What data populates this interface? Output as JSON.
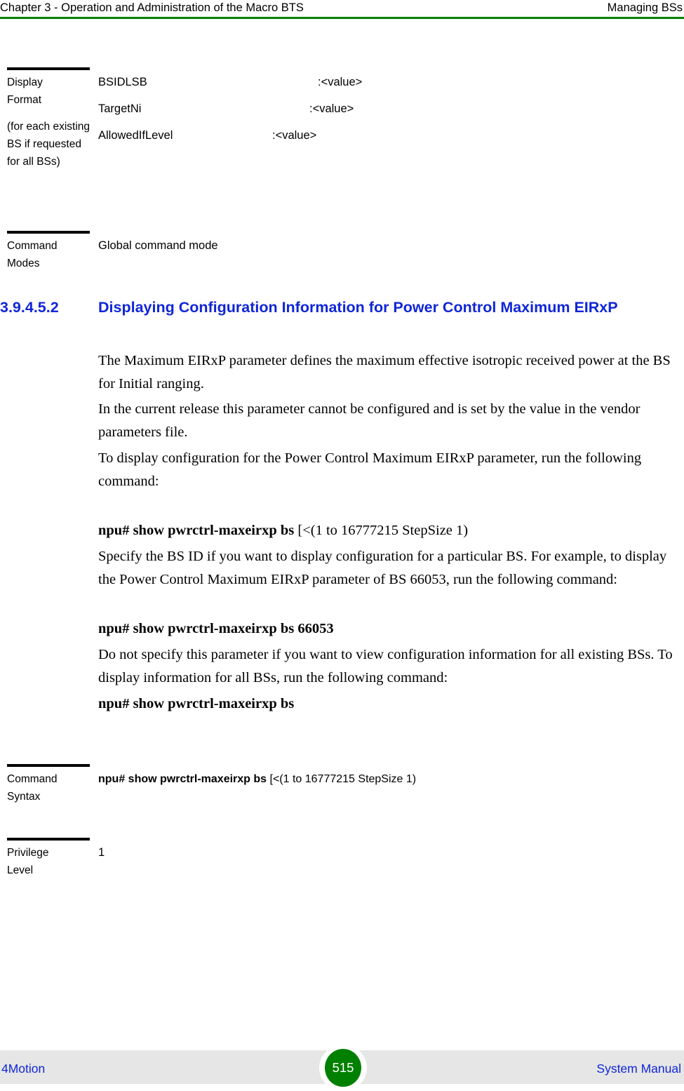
{
  "header": {
    "left": "Chapter 3 - Operation and Administration of the Macro BTS",
    "right": "Managing BSs",
    "rule_color": "#008000"
  },
  "display_format_table": {
    "label": "Display Format",
    "label_line1": "Display",
    "label_line2": "Format",
    "label_note": "(for each existing BS if requested for all BSs)",
    "rows": [
      {
        "name": "BSIDLSB",
        "value": ":<value>"
      },
      {
        "name": "TargetNi",
        "value": ":<value>"
      },
      {
        "name": "AllowedIfLevel",
        "value": ":<value>"
      }
    ]
  },
  "command_modes_table": {
    "label_line1": "Command",
    "label_line2": "Modes",
    "value": "Global command mode"
  },
  "section": {
    "number": "3.9.4.5.2",
    "title": "Displaying Configuration Information for Power Control Maximum EIRxP",
    "color": "#1026d8"
  },
  "paragraphs": [
    {
      "id": "p1",
      "text": "The Maximum EIRxP parameter defines the maximum effective isotropic received power at the BS for Initial ranging."
    },
    {
      "id": "p2",
      "text": "In the current release this parameter cannot be configured and is set by the value in the vendor parameters file."
    },
    {
      "id": "p3",
      "text": "To display configuration for the Power Control Maximum EIRxP parameter, run the following command:"
    },
    {
      "id": "cmd1_bold",
      "text": "npu# show pwrctrl-maxeirxp bs"
    },
    {
      "id": "cmd1_plain",
      "text": " [<(1 to 16777215 StepSize 1)"
    },
    {
      "id": "p4",
      "text": "Specify the BS ID if you want to display configuration for a particular BS. For example, to display the Power Control Maximum EIRxP parameter of BS 66053, run the following command:"
    },
    {
      "id": "cmd2",
      "text": "npu# show pwrctrl-maxeirxp bs 66053"
    },
    {
      "id": "p5",
      "text": "Do not specify this parameter if you want to view configuration information for all existing BSs. To display information for all BSs, run the following command:"
    },
    {
      "id": "cmd3",
      "text": "npu# show pwrctrl-maxeirxp bs"
    }
  ],
  "command_syntax_table": {
    "label_line1": "Command",
    "label_line2": "Syntax",
    "value_bold": "npu# show pwrctrl-maxeirxp bs",
    "value_plain": " [<(1 to 16777215 StepSize 1)"
  },
  "privilege_level_table": {
    "label_line1": "Privilege",
    "label_line2": "Level",
    "value": "1"
  },
  "footer": {
    "left": "4Motion",
    "page": "515",
    "right": "System Manual",
    "band_color": "#e6e6e6",
    "badge_color": "#008000",
    "link_color": "#1026d8"
  }
}
